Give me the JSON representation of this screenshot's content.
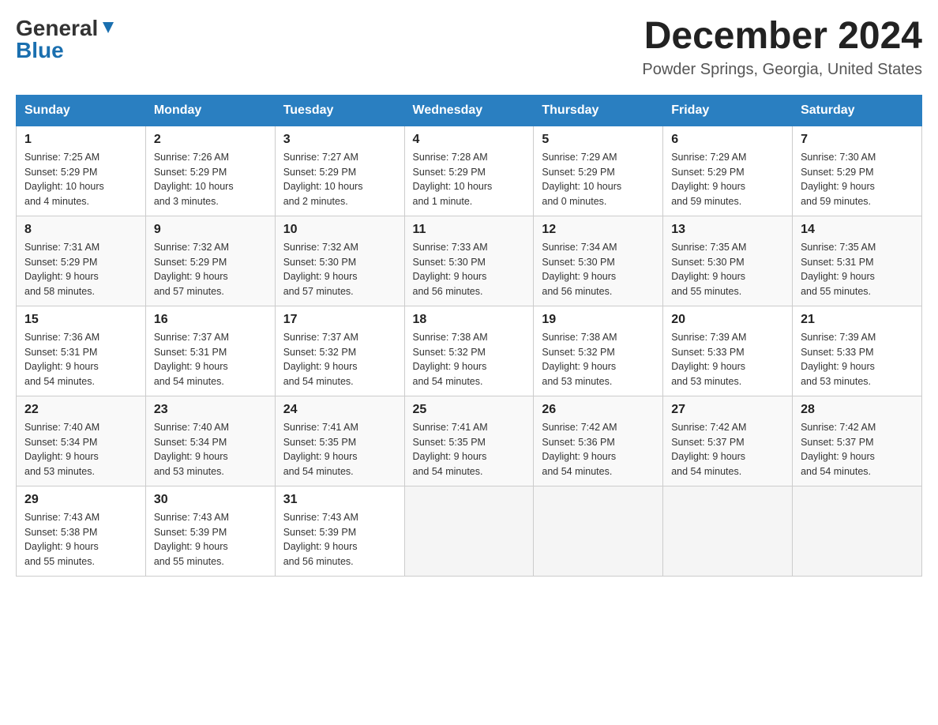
{
  "header": {
    "logo_general": "General",
    "logo_blue": "Blue",
    "month_title": "December 2024",
    "location": "Powder Springs, Georgia, United States"
  },
  "days_of_week": [
    "Sunday",
    "Monday",
    "Tuesday",
    "Wednesday",
    "Thursday",
    "Friday",
    "Saturday"
  ],
  "weeks": [
    [
      {
        "day": "1",
        "sunrise": "7:25 AM",
        "sunset": "5:29 PM",
        "daylight": "10 hours and 4 minutes."
      },
      {
        "day": "2",
        "sunrise": "7:26 AM",
        "sunset": "5:29 PM",
        "daylight": "10 hours and 3 minutes."
      },
      {
        "day": "3",
        "sunrise": "7:27 AM",
        "sunset": "5:29 PM",
        "daylight": "10 hours and 2 minutes."
      },
      {
        "day": "4",
        "sunrise": "7:28 AM",
        "sunset": "5:29 PM",
        "daylight": "10 hours and 1 minute."
      },
      {
        "day": "5",
        "sunrise": "7:29 AM",
        "sunset": "5:29 PM",
        "daylight": "10 hours and 0 minutes."
      },
      {
        "day": "6",
        "sunrise": "7:29 AM",
        "sunset": "5:29 PM",
        "daylight": "9 hours and 59 minutes."
      },
      {
        "day": "7",
        "sunrise": "7:30 AM",
        "sunset": "5:29 PM",
        "daylight": "9 hours and 59 minutes."
      }
    ],
    [
      {
        "day": "8",
        "sunrise": "7:31 AM",
        "sunset": "5:29 PM",
        "daylight": "9 hours and 58 minutes."
      },
      {
        "day": "9",
        "sunrise": "7:32 AM",
        "sunset": "5:29 PM",
        "daylight": "9 hours and 57 minutes."
      },
      {
        "day": "10",
        "sunrise": "7:32 AM",
        "sunset": "5:30 PM",
        "daylight": "9 hours and 57 minutes."
      },
      {
        "day": "11",
        "sunrise": "7:33 AM",
        "sunset": "5:30 PM",
        "daylight": "9 hours and 56 minutes."
      },
      {
        "day": "12",
        "sunrise": "7:34 AM",
        "sunset": "5:30 PM",
        "daylight": "9 hours and 56 minutes."
      },
      {
        "day": "13",
        "sunrise": "7:35 AM",
        "sunset": "5:30 PM",
        "daylight": "9 hours and 55 minutes."
      },
      {
        "day": "14",
        "sunrise": "7:35 AM",
        "sunset": "5:31 PM",
        "daylight": "9 hours and 55 minutes."
      }
    ],
    [
      {
        "day": "15",
        "sunrise": "7:36 AM",
        "sunset": "5:31 PM",
        "daylight": "9 hours and 54 minutes."
      },
      {
        "day": "16",
        "sunrise": "7:37 AM",
        "sunset": "5:31 PM",
        "daylight": "9 hours and 54 minutes."
      },
      {
        "day": "17",
        "sunrise": "7:37 AM",
        "sunset": "5:32 PM",
        "daylight": "9 hours and 54 minutes."
      },
      {
        "day": "18",
        "sunrise": "7:38 AM",
        "sunset": "5:32 PM",
        "daylight": "9 hours and 54 minutes."
      },
      {
        "day": "19",
        "sunrise": "7:38 AM",
        "sunset": "5:32 PM",
        "daylight": "9 hours and 53 minutes."
      },
      {
        "day": "20",
        "sunrise": "7:39 AM",
        "sunset": "5:33 PM",
        "daylight": "9 hours and 53 minutes."
      },
      {
        "day": "21",
        "sunrise": "7:39 AM",
        "sunset": "5:33 PM",
        "daylight": "9 hours and 53 minutes."
      }
    ],
    [
      {
        "day": "22",
        "sunrise": "7:40 AM",
        "sunset": "5:34 PM",
        "daylight": "9 hours and 53 minutes."
      },
      {
        "day": "23",
        "sunrise": "7:40 AM",
        "sunset": "5:34 PM",
        "daylight": "9 hours and 53 minutes."
      },
      {
        "day": "24",
        "sunrise": "7:41 AM",
        "sunset": "5:35 PM",
        "daylight": "9 hours and 54 minutes."
      },
      {
        "day": "25",
        "sunrise": "7:41 AM",
        "sunset": "5:35 PM",
        "daylight": "9 hours and 54 minutes."
      },
      {
        "day": "26",
        "sunrise": "7:42 AM",
        "sunset": "5:36 PM",
        "daylight": "9 hours and 54 minutes."
      },
      {
        "day": "27",
        "sunrise": "7:42 AM",
        "sunset": "5:37 PM",
        "daylight": "9 hours and 54 minutes."
      },
      {
        "day": "28",
        "sunrise": "7:42 AM",
        "sunset": "5:37 PM",
        "daylight": "9 hours and 54 minutes."
      }
    ],
    [
      {
        "day": "29",
        "sunrise": "7:43 AM",
        "sunset": "5:38 PM",
        "daylight": "9 hours and 55 minutes."
      },
      {
        "day": "30",
        "sunrise": "7:43 AM",
        "sunset": "5:39 PM",
        "daylight": "9 hours and 55 minutes."
      },
      {
        "day": "31",
        "sunrise": "7:43 AM",
        "sunset": "5:39 PM",
        "daylight": "9 hours and 56 minutes."
      },
      {
        "day": "",
        "sunrise": "",
        "sunset": "",
        "daylight": ""
      },
      {
        "day": "",
        "sunrise": "",
        "sunset": "",
        "daylight": ""
      },
      {
        "day": "",
        "sunrise": "",
        "sunset": "",
        "daylight": ""
      },
      {
        "day": "",
        "sunrise": "",
        "sunset": "",
        "daylight": ""
      }
    ]
  ]
}
